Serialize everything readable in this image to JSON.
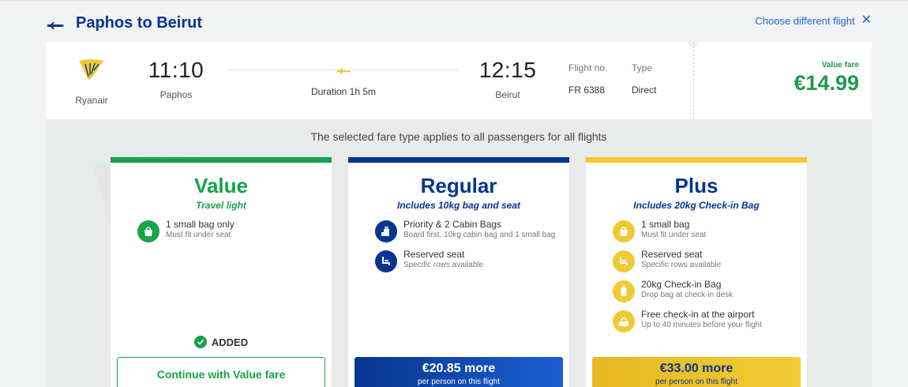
{
  "header": {
    "title": "Paphos to Beirut",
    "change_link": "Choose different flight"
  },
  "flight": {
    "airline": "Ryanair",
    "departure_time": "11:10",
    "departure_city": "Paphos",
    "duration": "Duration 1h 5m",
    "arrival_time": "12:15",
    "arrival_city": "Beirut",
    "flight_no_label": "Flight no.",
    "flight_no": "FR 6388",
    "type_label": "Type",
    "type": "Direct",
    "fare_label": "Value fare",
    "fare_price": "€14.99"
  },
  "notice": "The selected fare type applies to all passengers for all flights",
  "fares": {
    "value": {
      "name": "Value",
      "tagline": "Travel light",
      "features": [
        {
          "title": "1 small bag only",
          "sub": "Must fit under seat",
          "icon": "small-bag-icon"
        }
      ],
      "added_label": "ADDED",
      "button": "Continue with Value fare"
    },
    "regular": {
      "name": "Regular",
      "tagline": "Includes 10kg bag and seat",
      "features": [
        {
          "title": "Priority & 2 Cabin Bags",
          "sub": "Board first, 10kg cabin bag and 1 small bag",
          "icon": "cabin-bags-icon"
        },
        {
          "title": "Reserved seat",
          "sub": "Specific rows available",
          "icon": "seat-icon"
        }
      ],
      "price": "€20.85 more",
      "price_sub": "per person on this flight"
    },
    "plus": {
      "name": "Plus",
      "tagline": "Includes 20kg Check-in Bag",
      "features": [
        {
          "title": "1 small bag",
          "sub": "Must fit under seat",
          "icon": "small-bag-icon"
        },
        {
          "title": "Reserved seat",
          "sub": "Specific rows available",
          "icon": "seat-icon"
        },
        {
          "title": "20kg Check-in Bag",
          "sub": "Drop bag at check-in desk",
          "icon": "checkin-bag-icon"
        },
        {
          "title": "Free check-in at the airport",
          "sub": "Up to 40 minutes before your flight",
          "icon": "airport-checkin-icon"
        }
      ],
      "price": "€33.00 more",
      "price_sub": "per person on this flight"
    }
  },
  "colors": {
    "brand_navy": "#073590",
    "value_green": "#17a34a",
    "plus_yellow": "#f1c933",
    "link_blue": "#1c68d8"
  }
}
